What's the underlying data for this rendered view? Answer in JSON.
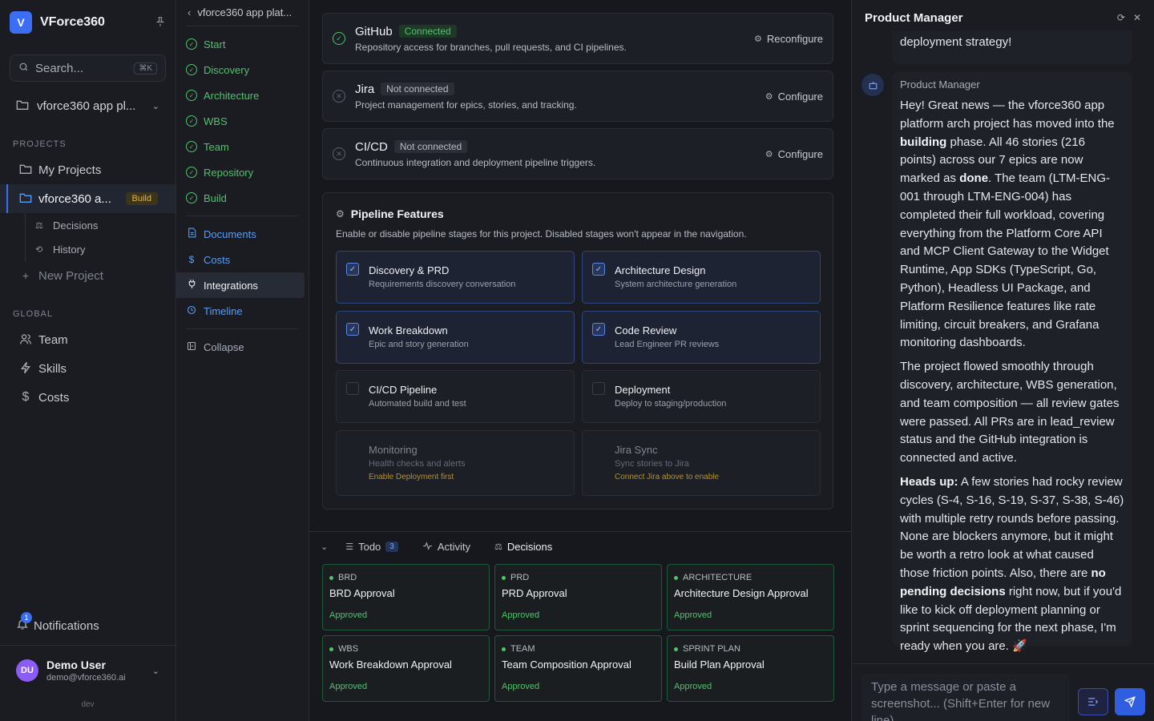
{
  "sidebar": {
    "brand_letter": "V",
    "brand_name": "VForce360",
    "search_placeholder": "Search...",
    "search_shortcut": "⌘K",
    "project_selector": "vforce360 app pl...",
    "projects_label": "PROJECTS",
    "projects": [
      {
        "label": "My Projects"
      },
      {
        "label": "vforce360 a...",
        "badge": "Build"
      }
    ],
    "sub_items": [
      {
        "label": "Decisions"
      },
      {
        "label": "History"
      }
    ],
    "new_project": "New Project",
    "global_label": "GLOBAL",
    "global_items": [
      {
        "label": "Team"
      },
      {
        "label": "Skills"
      },
      {
        "label": "Costs"
      }
    ],
    "notifications_label": "Notifications",
    "notifications_count": "1",
    "user": {
      "initials": "DU",
      "name": "Demo User",
      "email": "demo@vforce360.ai"
    },
    "env": "dev"
  },
  "stagenav": {
    "breadcrumb": "vforce360 app plat...",
    "stages": [
      "Start",
      "Discovery",
      "Architecture",
      "WBS",
      "Team",
      "Repository",
      "Build"
    ],
    "tools": [
      "Documents",
      "Costs",
      "Integrations",
      "Timeline"
    ],
    "collapse": "Collapse"
  },
  "integrations": [
    {
      "name": "GitHub",
      "status": "Connected",
      "desc": "Repository access for branches, pull requests, and CI pipelines.",
      "action": "Reconfigure"
    },
    {
      "name": "Jira",
      "status": "Not connected",
      "desc": "Project management for epics, stories, and tracking.",
      "action": "Configure"
    },
    {
      "name": "CI/CD",
      "status": "Not connected",
      "desc": "Continuous integration and deployment pipeline triggers.",
      "action": "Configure"
    }
  ],
  "pipeline": {
    "title": "Pipeline Features",
    "desc": "Enable or disable pipeline stages for this project. Disabled stages won't appear in the navigation.",
    "features": [
      {
        "title": "Discovery & PRD",
        "sub": "Requirements discovery conversation",
        "checked": true
      },
      {
        "title": "Architecture Design",
        "sub": "System architecture generation",
        "checked": true
      },
      {
        "title": "Work Breakdown",
        "sub": "Epic and story generation",
        "checked": true
      },
      {
        "title": "Code Review",
        "sub": "Lead Engineer PR reviews",
        "checked": true
      },
      {
        "title": "CI/CD Pipeline",
        "sub": "Automated build and test",
        "checked": false
      },
      {
        "title": "Deployment",
        "sub": "Deploy to staging/production",
        "checked": false
      },
      {
        "title": "Monitoring",
        "sub": "Health checks and alerts",
        "warn": "Enable Deployment first",
        "disabled": true
      },
      {
        "title": "Jira Sync",
        "sub": "Sync stories to Jira",
        "warn": "Connect Jira above to enable",
        "disabled": true
      }
    ]
  },
  "bottom_tabs": {
    "todo": "Todo",
    "todo_count": "3",
    "activity": "Activity",
    "decisions": "Decisions"
  },
  "decisions": [
    {
      "category": "BRD",
      "title": "BRD Approval",
      "status": "Approved"
    },
    {
      "category": "PRD",
      "title": "PRD Approval",
      "status": "Approved"
    },
    {
      "category": "ARCHITECTURE",
      "title": "Architecture Design Approval",
      "status": "Approved"
    },
    {
      "category": "WBS",
      "title": "Work Breakdown Approval",
      "status": "Approved"
    },
    {
      "category": "TEAM",
      "title": "Team Composition Approval",
      "status": "Approved"
    },
    {
      "category": "SPRINT PLAN",
      "title": "Build Plan Approval",
      "status": "Approved"
    }
  ],
  "chat": {
    "title": "Product Manager",
    "prev_tail": "deployment strategy!",
    "author": "Product Manager",
    "p1": [
      {
        "t": "Hey! Great news — the vforce360 app platform arch project has moved into the "
      },
      {
        "t": "building",
        "b": true
      },
      {
        "t": " phase. All 46 stories (216 points) across our 7 epics are now marked as "
      },
      {
        "t": "done",
        "b": true
      },
      {
        "t": ". The team (LTM-ENG-001 through LTM-ENG-004) has completed their full workload, covering everything from the Platform Core API and MCP Client Gateway to the Widget Runtime, App SDKs (TypeScript, Go, Python), Headless UI Package, and Platform Resilience features like rate limiting, circuit breakers, and Grafana monitoring dashboards."
      }
    ],
    "p2": [
      {
        "t": "The project flowed smoothly through discovery, architecture, WBS generation, and team composition — all review gates were passed. All PRs are in lead_review status and the GitHub integration is connected and active."
      }
    ],
    "p3": [
      {
        "t": "Heads up:",
        "b": true
      },
      {
        "t": " A few stories had rocky review cycles (S-4, S-16, S-19, S-37, S-38, S-46) with multiple retry rounds before passing. None are blockers anymore, but it might be worth a retro look at what caused those friction points. Also, there are "
      },
      {
        "t": "no pending decisions",
        "b": true
      },
      {
        "t": " right now, but if you'd like to kick off deployment planning or sprint sequencing for the next phase, I'm ready when you are. 🚀"
      }
    ],
    "composer_placeholder": "Type a message or paste a screenshot... (Shift+Enter for new line)"
  }
}
